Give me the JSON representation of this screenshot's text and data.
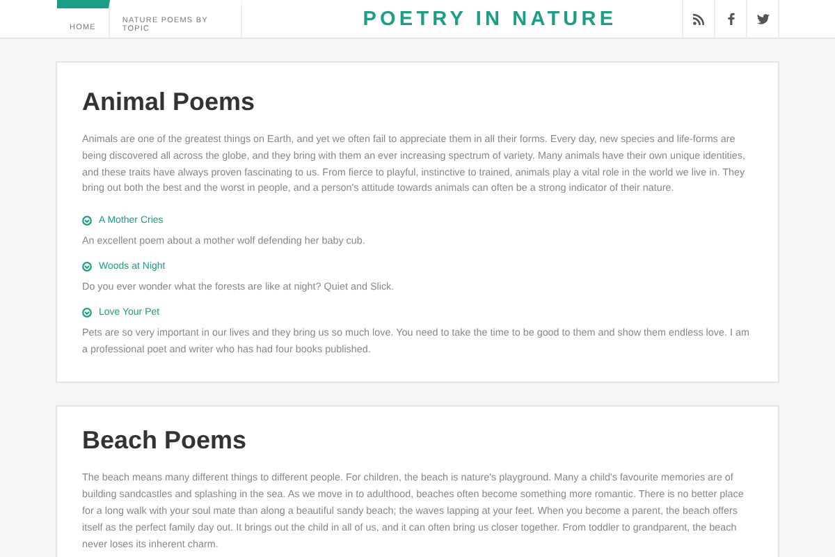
{
  "header": {
    "nav": [
      {
        "label": "HOME",
        "selected": true
      },
      {
        "label": "NATURE POEMS BY TOPIC",
        "selected": false
      }
    ],
    "site_title": "POETRY IN NATURE",
    "social": [
      {
        "kind": "rss"
      },
      {
        "kind": "facebook"
      },
      {
        "kind": "twitter"
      }
    ]
  },
  "sections": [
    {
      "title": "Animal Poems",
      "intro": "Animals are one of the greatest things on Earth, and yet we often fail to appreciate them in all their forms. Every day, new species and life-forms are being discovered all across the globe, and they bring with them an ever increasing spectrum of variety. Many animals have their own unique identities, and these traits have always proven fascinating to us. From fierce to playful, instinctive to trained, animals play a vital role in the world we live in. They bring out both the best and the worst in people, and a person's attitude towards animals can often be a strong indicator of their nature.",
      "poems": [
        {
          "title": "A Mother Cries",
          "summary": "An excellent poem about a mother wolf defending her baby cub."
        },
        {
          "title": "Woods at Night",
          "summary": "Do you ever wonder what the forests are like at night? Quiet and Slick."
        },
        {
          "title": "Love Your Pet",
          "summary": "Pets are so very important in our lives and they bring us so much love. You need to take the time to be good to them and show them endless love. I am a professional poet and writer who has had four books published."
        }
      ]
    },
    {
      "title": "Beach Poems",
      "intro": "The beach means many different things to different people. For children, the beach is nature's playground. Many a child's favourite memories are of building sandcastles and splashing in the sea. As we move in to adulthood, beaches often become something more romantic. There is no better place for a long walk with your soul mate than along a beautiful sandy beach; the waves lapping at your feet. When you become a parent, the beach offers itself as the perfect family day out. It brings out the child in all of us, and it can often bring us closer together. From toddler to grandparent, the beach never loses its inherent charm."
    }
  ]
}
